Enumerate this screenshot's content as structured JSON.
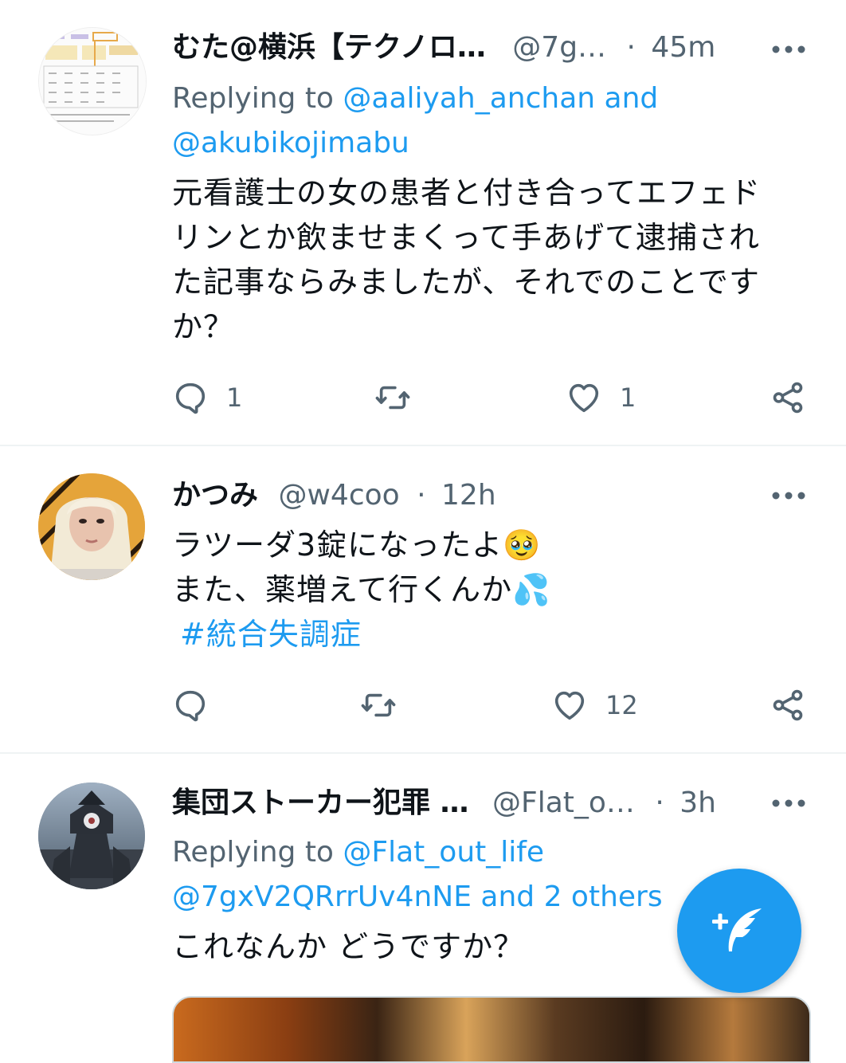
{
  "tweets": [
    {
      "name": "むた@横浜【テクノロ…",
      "handle": "@7g…",
      "dot": "·",
      "time": "45m",
      "replying_prefix": "Replying to ",
      "replying_line1": "@aaliyah_anchan and",
      "replying_line2": "@akubikojimabu",
      "text_lines": [
        "元看護士の女の患者と付き合ってエフェド",
        "リンとか飲ませまくって手あげて逮捕され",
        "た記事ならみましたが、それでのことです",
        "か？"
      ],
      "reply_count": "1",
      "retweet_count": "",
      "like_count": "1"
    },
    {
      "name": "かつみ",
      "handle": "@w4coo",
      "dot": "·",
      "time": "12h",
      "text_lines": [
        "ラツーダ3錠になったよ🥹",
        "また、薬増えて行くんか💦"
      ],
      "hashtag": "#統合失調症",
      "reply_count": "",
      "retweet_count": "",
      "like_count": "12"
    },
    {
      "name": "集団ストーカー犯罪 …",
      "handle": "@Flat_o…",
      "dot": "·",
      "time": "3h",
      "replying_prefix": "Replying to ",
      "replying_line1": "@Flat_out_life",
      "replying_line2": "@7gxV2QRrrUv4nNE and 2 others",
      "text_lines": [
        "これなんか どうですか？"
      ]
    }
  ],
  "icons": {
    "reply": "reply-icon",
    "retweet": "retweet-icon",
    "like": "like-icon",
    "share": "share-icon",
    "more": "more-icon",
    "compose": "compose-tweet-icon"
  },
  "colors": {
    "accent": "#1d9bf0",
    "secondary_text": "#536471",
    "primary_text": "#0f1419",
    "divider": "#eff3f4"
  }
}
